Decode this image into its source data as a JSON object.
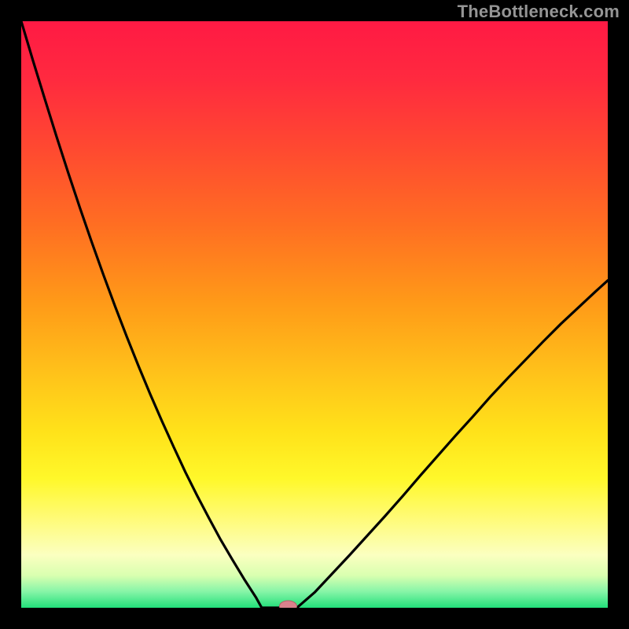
{
  "watermark": "TheBottleneck.com",
  "colors": {
    "frame": "#000000",
    "curve": "#000000",
    "marker_fill": "#d9818c",
    "marker_stroke": "#b65f67",
    "gradient_stops": [
      {
        "offset": 0.0,
        "color": "#ff1a44"
      },
      {
        "offset": 0.1,
        "color": "#ff2a3f"
      },
      {
        "offset": 0.22,
        "color": "#ff4a30"
      },
      {
        "offset": 0.35,
        "color": "#ff6f22"
      },
      {
        "offset": 0.48,
        "color": "#ff9a18"
      },
      {
        "offset": 0.6,
        "color": "#ffc21a"
      },
      {
        "offset": 0.7,
        "color": "#ffe21a"
      },
      {
        "offset": 0.78,
        "color": "#fff82a"
      },
      {
        "offset": 0.85,
        "color": "#fffb7a"
      },
      {
        "offset": 0.91,
        "color": "#fbffc0"
      },
      {
        "offset": 0.945,
        "color": "#d9ffb0"
      },
      {
        "offset": 0.972,
        "color": "#88f5a8"
      },
      {
        "offset": 1.0,
        "color": "#22e07a"
      }
    ]
  },
  "chart_data": {
    "type": "line",
    "title": "",
    "xlabel": "",
    "ylabel": "",
    "xlim": [
      0,
      100
    ],
    "ylim": [
      0,
      100
    ],
    "grid": false,
    "legend": false,
    "marker": {
      "x": 45.5,
      "y": 0
    },
    "flat_segment": {
      "x_start": 41,
      "x_end": 47,
      "y": 0
    },
    "series": [
      {
        "name": "left",
        "x": [
          0.0,
          2.0,
          4.0,
          6.0,
          8.0,
          10.0,
          12.0,
          14.0,
          16.0,
          18.0,
          20.0,
          22.0,
          24.0,
          26.0,
          28.0,
          30.0,
          32.0,
          34.0,
          36.0,
          38.0,
          40.0,
          41.0
        ],
        "y": [
          100.0,
          93.3,
          86.8,
          80.4,
          74.2,
          68.2,
          62.4,
          56.8,
          51.4,
          46.2,
          41.2,
          36.4,
          31.8,
          27.4,
          23.1,
          19.1,
          15.3,
          11.6,
          8.2,
          4.9,
          1.8,
          0.0
        ]
      },
      {
        "name": "right",
        "x": [
          47.0,
          50.0,
          53.0,
          56.0,
          59.0,
          62.0,
          65.0,
          68.0,
          71.0,
          74.0,
          77.0,
          80.0,
          83.0,
          86.0,
          89.0,
          92.0,
          95.0,
          98.0,
          100.0
        ],
        "y": [
          0.0,
          2.6,
          5.8,
          9.0,
          12.3,
          15.6,
          19.0,
          22.5,
          25.9,
          29.3,
          32.6,
          36.0,
          39.2,
          42.3,
          45.4,
          48.4,
          51.2,
          54.0,
          55.8
        ]
      }
    ]
  }
}
